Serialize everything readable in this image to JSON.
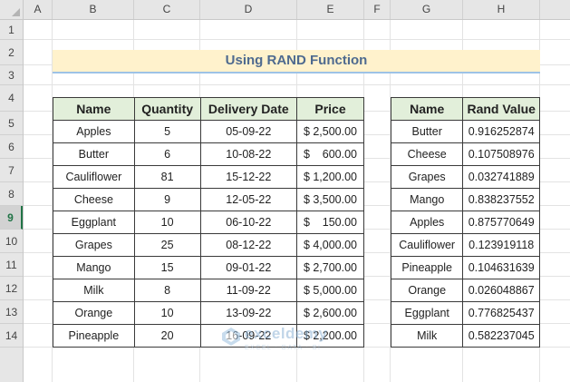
{
  "columns": [
    "A",
    "B",
    "C",
    "D",
    "E",
    "F",
    "G",
    "H"
  ],
  "rows": [
    "1",
    "2",
    "3",
    "4",
    "5",
    "6",
    "7",
    "8",
    "9",
    "10",
    "11",
    "12",
    "13",
    "14"
  ],
  "active_row": "9",
  "title": "Using RAND Function",
  "left_table": {
    "headers": [
      "Name",
      "Quantity",
      "Delivery Date",
      "Price"
    ],
    "rows": [
      {
        "name": "Apples",
        "qty": "5",
        "date": "05-09-22",
        "price_sym": "$",
        "price_val": "2,500.00"
      },
      {
        "name": "Butter",
        "qty": "6",
        "date": "10-08-22",
        "price_sym": "$",
        "price_val": "600.00"
      },
      {
        "name": "Cauliflower",
        "qty": "81",
        "date": "15-12-22",
        "price_sym": "$",
        "price_val": "1,200.00"
      },
      {
        "name": "Cheese",
        "qty": "9",
        "date": "12-05-22",
        "price_sym": "$",
        "price_val": "3,500.00"
      },
      {
        "name": "Eggplant",
        "qty": "10",
        "date": "06-10-22",
        "price_sym": "$",
        "price_val": "150.00"
      },
      {
        "name": "Grapes",
        "qty": "25",
        "date": "08-12-22",
        "price_sym": "$",
        "price_val": "4,000.00"
      },
      {
        "name": "Mango",
        "qty": "15",
        "date": "09-01-22",
        "price_sym": "$",
        "price_val": "2,700.00"
      },
      {
        "name": "Milk",
        "qty": "8",
        "date": "11-09-22",
        "price_sym": "$",
        "price_val": "5,000.00"
      },
      {
        "name": "Orange",
        "qty": "10",
        "date": "13-09-22",
        "price_sym": "$",
        "price_val": "2,600.00"
      },
      {
        "name": "Pineapple",
        "qty": "20",
        "date": "16-09-22",
        "price_sym": "$",
        "price_val": "2,200.00"
      }
    ]
  },
  "right_table": {
    "headers": [
      "Name",
      "Rand Value"
    ],
    "rows": [
      {
        "name": "Butter",
        "rand": "0.916252874"
      },
      {
        "name": "Cheese",
        "rand": "0.107508976"
      },
      {
        "name": "Grapes",
        "rand": "0.032741889"
      },
      {
        "name": "Mango",
        "rand": "0.838237552"
      },
      {
        "name": "Apples",
        "rand": "0.875770649"
      },
      {
        "name": "Cauliflower",
        "rand": "0.123919118"
      },
      {
        "name": "Pineapple",
        "rand": "0.104631639"
      },
      {
        "name": "Orange",
        "rand": "0.026048867"
      },
      {
        "name": "Eggplant",
        "rand": "0.776825437"
      },
      {
        "name": "Milk",
        "rand": "0.582237045"
      }
    ]
  },
  "watermark": {
    "brand": "exceldemy",
    "tagline": "EXCEL · DATA · BI"
  },
  "colors": {
    "header_fill": "#e2efda",
    "title_fill": "#fff2cc",
    "title_text": "#4e6a8f",
    "active_row": "#217346"
  }
}
